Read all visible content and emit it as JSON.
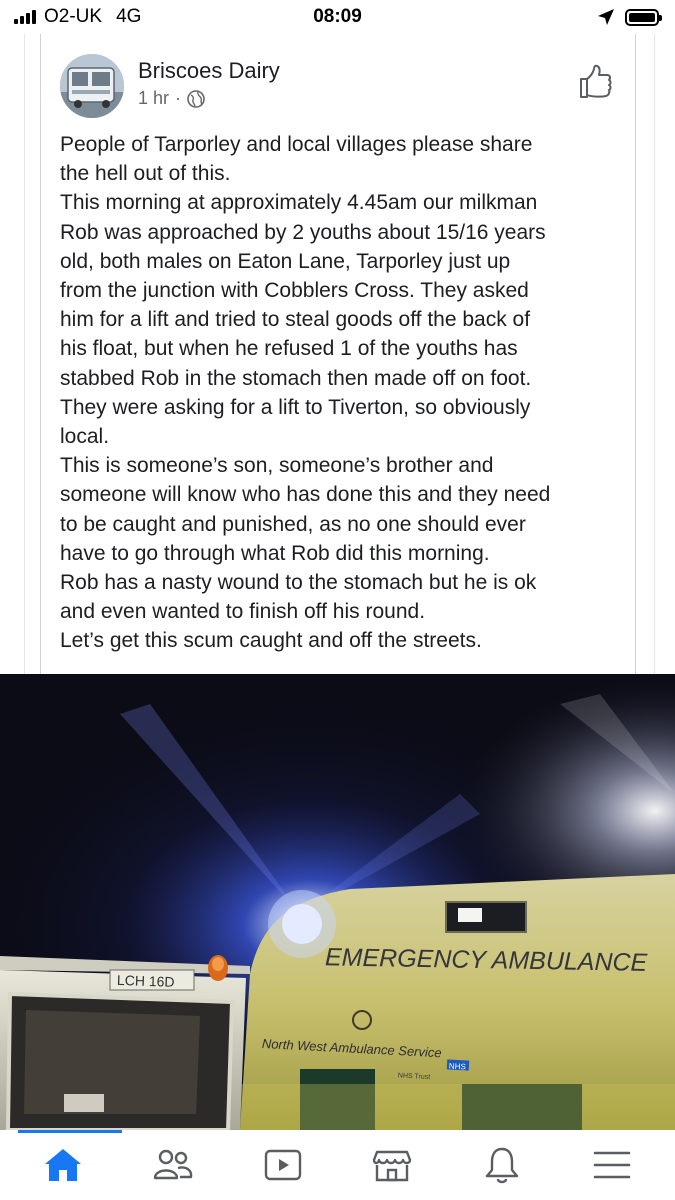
{
  "status_bar": {
    "carrier": "O2-UK",
    "network": "4G",
    "time": "08:09"
  },
  "post": {
    "author": "Briscoes Dairy",
    "timestamp": "1 hr",
    "separator": "·",
    "privacy_icon": "globe-icon",
    "lines": [
      "People of Tarporley and local villages please share",
      "the hell out of this.",
      "This morning at approximately 4.45am our milkman",
      "Rob was approached by 2 youths about 15/16 years",
      "old, both males on Eaton Lane, Tarporley just up",
      "from the junction with Cobblers Cross. They asked",
      "him for a lift and tried to steal goods off the back of",
      "his float, but when he refused 1 of the youths has",
      "stabbed Rob in the stomach then made off on foot.",
      "They were asking for a lift to Tiverton, so obviously",
      "local.",
      "This is someone’s son, someone’s brother and",
      "someone will know who has done this and they need",
      "to be caught and punished, as no one should ever",
      "have to go through what Rob did this morning.",
      "Rob has a nasty wound to the stomach but he is ok",
      "and even wanted to finish off his round.",
      "Let’s get this scum caught and off the streets."
    ]
  },
  "photo": {
    "ambulance_label": "EMERGENCY AMBULANCE",
    "service_label": "North West Ambulance Service",
    "trust_label": "NHS Trust",
    "nhs_badge": "NHS",
    "float_plate": "LCH 16D"
  },
  "bottom_nav": {
    "items": [
      {
        "name": "home",
        "icon": "home-icon",
        "active": true
      },
      {
        "name": "friends",
        "icon": "friends-icon",
        "active": false
      },
      {
        "name": "watch",
        "icon": "video-icon",
        "active": false
      },
      {
        "name": "marketplace",
        "icon": "marketplace-icon",
        "active": false
      },
      {
        "name": "notifications",
        "icon": "bell-icon",
        "active": false
      },
      {
        "name": "menu",
        "icon": "menu-icon",
        "active": false
      }
    ]
  },
  "colors": {
    "accent": "#1877f2",
    "text": "#1c1e21",
    "muted": "#65676b",
    "icon_gray": "#5a5d62"
  }
}
